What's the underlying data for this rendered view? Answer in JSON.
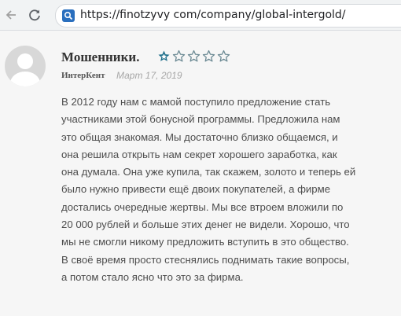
{
  "browser": {
    "url": "https://finotzyvy com/company/global-intergold/",
    "site_icon": "search-icon"
  },
  "review": {
    "title": "Мошенники.",
    "rating": 1,
    "max_rating": 5,
    "author": "ИнтерКент",
    "date": "Март 17, 2019",
    "text_lines": [
      "В 2012 году нам с мамой поступило предложение стать",
      "участниками этой бонусной программы. Предложила нам",
      "это общая знакомая. Мы достаточно близко общаемся, и",
      "она решила открыть нам секрет хорошего заработка, как",
      "она думала. Она уже купила, так скажем, золото и теперь ей",
      "было нужно привести ещё двоих покупателей, а фирме",
      "достались очередные жертвы. Мы все втроем вложили по",
      "20 000 рублей и больше этих денег не видели. Хорошо, что",
      "мы не смогли никому предложить вступить в это общество.",
      "В своё время просто стеснялись поднимать такие вопросы,",
      "а потом стало ясно что это за фирма."
    ]
  },
  "colors": {
    "star_filled": "#1f6f8b",
    "star_empty": "#6c8a94",
    "date": "#a6a6a6"
  }
}
